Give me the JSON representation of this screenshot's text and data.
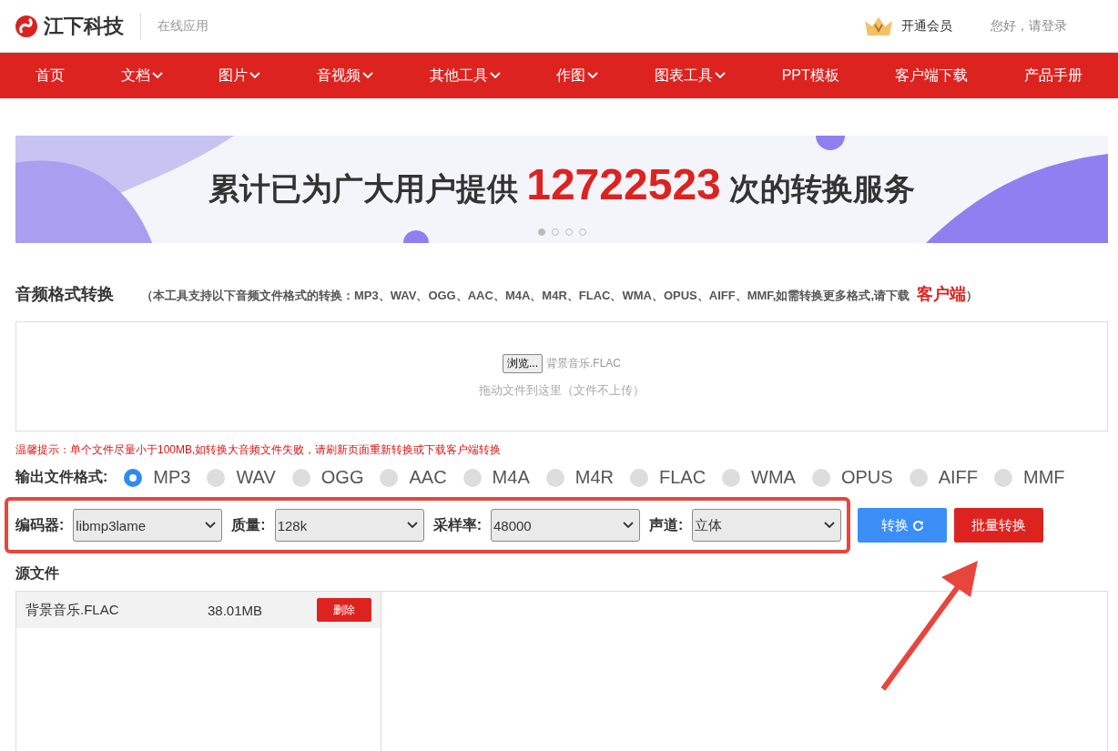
{
  "header": {
    "brand": "江下科技",
    "subtitle": "在线应用",
    "vip": "开通会员",
    "login": "您好，请登录"
  },
  "nav": [
    {
      "label": "首页",
      "has_menu": false
    },
    {
      "label": "文档",
      "has_menu": true
    },
    {
      "label": "图片",
      "has_menu": true
    },
    {
      "label": "音视频",
      "has_menu": true
    },
    {
      "label": "其他工具",
      "has_menu": true
    },
    {
      "label": "作图",
      "has_menu": true
    },
    {
      "label": "图表工具",
      "has_menu": true
    },
    {
      "label": "PPT模板",
      "has_menu": false
    },
    {
      "label": "客户端下载",
      "has_menu": false
    },
    {
      "label": "产品手册",
      "has_menu": false
    }
  ],
  "banner": {
    "before": "累计已为广大用户提供",
    "count": "12722523",
    "after": "次的转换服务",
    "dots": [
      {
        "selected": true
      },
      {
        "selected": false
      },
      {
        "selected": false
      },
      {
        "selected": false
      }
    ]
  },
  "section": {
    "title": "音频格式转换",
    "note": "（本工具支持以下音频文件格式的转换：MP3、WAV、OGG、AAC、M4A、M4R、FLAC、WMA、OPUS、AIFF、MMF,如需转换更多格式,请下载",
    "link": "客户端",
    "close": "）"
  },
  "upload": {
    "browse": "浏览...",
    "file": "背景音乐.FLAC",
    "hint": "拖动文件到这里（文件不上传）"
  },
  "warning": "温馨提示：单个文件尽量小于100MB,如转换大音频文件失败，请刷新页面重新转换或下载客户端转换",
  "format": {
    "label": "输出文件格式:",
    "options": [
      {
        "label": "MP3",
        "selected": true
      },
      {
        "label": "WAV",
        "selected": false
      },
      {
        "label": "OGG",
        "selected": false
      },
      {
        "label": "AAC",
        "selected": false
      },
      {
        "label": "M4A",
        "selected": false
      },
      {
        "label": "M4R",
        "selected": false
      },
      {
        "label": "FLAC",
        "selected": false
      },
      {
        "label": "WMA",
        "selected": false
      },
      {
        "label": "OPUS",
        "selected": false
      },
      {
        "label": "AIFF",
        "selected": false
      },
      {
        "label": "MMF",
        "selected": false
      }
    ]
  },
  "settings": [
    {
      "label": "编码器:",
      "value": "libmp3lame"
    },
    {
      "label": "质量:",
      "value": "128k"
    },
    {
      "label": "采样率:",
      "value": "48000"
    },
    {
      "label": "声道:",
      "value": "立体"
    }
  ],
  "buttons": {
    "convert": "转换",
    "batch": "批量转换"
  },
  "source": {
    "title": "源文件",
    "files": [
      {
        "name": "背景音乐.FLAC",
        "size": "38.01MB",
        "delete": "删除"
      }
    ]
  }
}
